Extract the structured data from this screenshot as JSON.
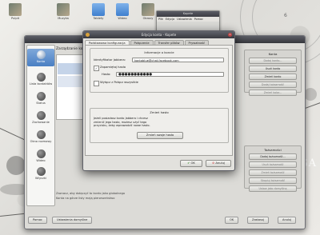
{
  "desktop": {
    "icons": [
      {
        "label": "Pulpit",
        "icon": "photo-icon"
      },
      {
        "label": "Muzyka",
        "icon": "photo-icon"
      },
      {
        "label": "Tablety",
        "icon": "folder-icon"
      },
      {
        "label": "Wideo",
        "icon": "folder-icon"
      },
      {
        "label": "Obrazy",
        "icon": "photo-icon"
      }
    ],
    "watermark": "GA",
    "clock_digit": "6"
  },
  "back_window": {
    "title": "Kopete",
    "menu": [
      "Plik",
      "Edycja",
      "Ustawienia",
      "Pomoc"
    ]
  },
  "main_window": {
    "panel_title": "Zarządzanie kontami",
    "sidebar": [
      {
        "label": "Konta",
        "icon": "accounts-icon",
        "selected": true
      },
      {
        "label": "Lista kontaktów",
        "icon": "contact-list-icon",
        "selected": false
      },
      {
        "label": "Status",
        "icon": "status-icon",
        "selected": false
      },
      {
        "label": "Zachowanie",
        "icon": "behavior-icon",
        "selected": false
      },
      {
        "label": "Okno rozmowy",
        "icon": "chat-window-icon",
        "selected": false
      },
      {
        "label": "Wideo",
        "icon": "video-icon",
        "selected": false
      },
      {
        "label": "Wtyczki",
        "icon": "plugins-icon",
        "selected": false
      }
    ],
    "accounts_group": {
      "title": "Konta",
      "buttons": [
        "Dodaj konto...",
        "Usuń konto",
        "Zmień konto",
        "Dodaj tożsamość",
        "Zmień kolor..."
      ]
    },
    "identities_group": {
      "title": "Tożsamości",
      "buttons": [
        "Dodaj tożsamość...",
        "Usuń tożsamość",
        "Zmień tożsamość",
        "Skopiuj tożsamość",
        "Ustaw jako domyślną"
      ]
    },
    "footnote_lines": [
      "Zaznacz, aby dołączyć to konto jako globalnego",
      "Konta na górze listy mają pierwszeństwo"
    ],
    "bottom_buttons": {
      "help": "Pomoc",
      "defaults": "Ustawienia domyślne",
      "ok": "OK",
      "apply": "Zastosuj",
      "cancel": "Anuluj"
    }
  },
  "dialog": {
    "title": "Edycja konta - Kopete",
    "tabs": [
      "Podstawowa konfiguracja",
      "Połączenie",
      "Transfer plików",
      "Prywatność"
    ],
    "active_tab": 0,
    "account_info": {
      "title": "Informacje o koncie",
      "jid_label": "Identyfikator Jabbera:",
      "jid_value": "kontoblue@chat.facebook.com",
      "remember_label": "Zapamiętaj hasło",
      "remember_checked": true,
      "password_label": "Hasło:",
      "password_value": "●●●●●●●●●●●",
      "exclude_label": "Wyłącz z Połącz wszystkie",
      "exclude_checked": false
    },
    "change_password": {
      "title": "Zmień hasło",
      "description": "Jeżeli posiadasz konto Jabbera i chcesz zmienić jego hasło, możesz użyć tego przycisku, żeby wprowadzić nowe hasło.",
      "button": "Zmień swoje hasło"
    },
    "ok": "OK",
    "cancel": "Anuluj"
  }
}
